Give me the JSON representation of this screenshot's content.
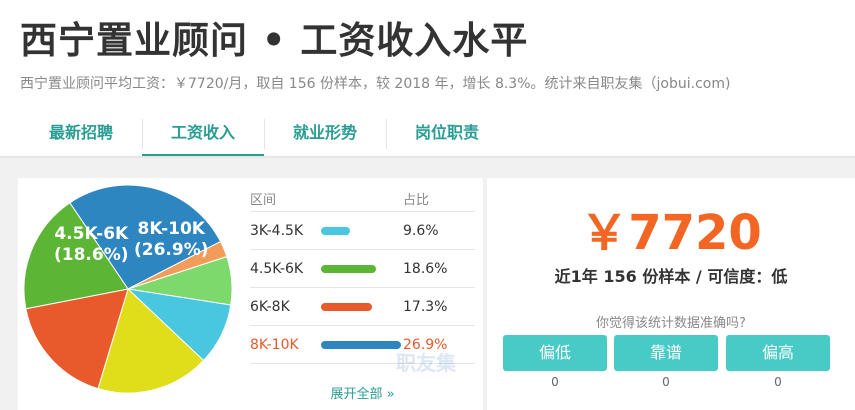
{
  "page": {
    "title": "西宁置业顾问 • 工资收入水平",
    "subtitle": "西宁置业顾问平均工资：￥7720/月，取自 156 份样本，较 2018 年，增长 8.3%。统计来自职友集（jobui.com)"
  },
  "tabs": [
    {
      "label": "最新招聘",
      "active": false
    },
    {
      "label": "工资收入",
      "active": true
    },
    {
      "label": "就业形势",
      "active": false
    },
    {
      "label": "岗位职责",
      "active": false
    }
  ],
  "pie": {
    "slices": [
      {
        "name": "8K-10K",
        "percent": 26.9,
        "color": "#2e86c1"
      },
      {
        "name": "orange-small",
        "percent": 2.5,
        "color": "#f39c5a"
      },
      {
        "name": "lightgreen",
        "percent": 7.5,
        "color": "#7ed96c"
      },
      {
        "name": "3K-4.5K",
        "percent": 9.6,
        "color": "#4ac7e0"
      },
      {
        "name": "yellow",
        "percent": 17.6,
        "color": "#e0de1a"
      },
      {
        "name": "6K-8K",
        "percent": 17.3,
        "color": "#e85a2c"
      },
      {
        "name": "4.5K-6K",
        "percent": 18.6,
        "color": "#5db536"
      }
    ],
    "label_8k": {
      "range": "8K-10K",
      "pct": "(26.9%)"
    },
    "label_45k": {
      "range": "4.5K-6K",
      "pct": "(18.6%)"
    }
  },
  "table": {
    "header_range": "区间",
    "header_ratio": "占比",
    "rows": [
      {
        "range": "3K-4.5K",
        "ratio": "9.6%",
        "value": 9.6,
        "color": "#4ac7e0",
        "highlight": false
      },
      {
        "range": "4.5K-6K",
        "ratio": "18.6%",
        "value": 18.6,
        "color": "#5db536",
        "highlight": false
      },
      {
        "range": "6K-8K",
        "ratio": "17.3%",
        "value": 17.3,
        "color": "#e85a2c",
        "highlight": false
      },
      {
        "range": "8K-10K",
        "ratio": "26.9%",
        "value": 26.9,
        "color": "#2e86c1",
        "highlight": true
      }
    ],
    "more_label": "展开全部 »"
  },
  "summary": {
    "salary": "￥7720",
    "sample_text": "近1年 156 份样本 / 可信度：低",
    "question": "你觉得该统计数据准确吗?"
  },
  "votes": [
    {
      "label": "偏低",
      "count": "0"
    },
    {
      "label": "靠谱",
      "count": "0"
    },
    {
      "label": "偏高",
      "count": "0"
    }
  ],
  "watermark": "职友集",
  "colors": {
    "accent": "#2a9d93",
    "salary": "#f26522",
    "vote": "#48cbc7"
  }
}
